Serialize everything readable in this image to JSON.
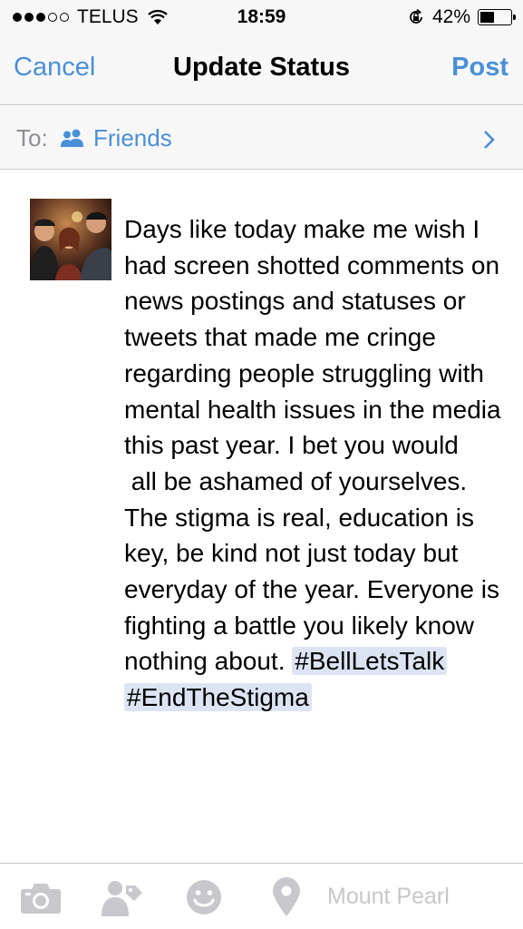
{
  "status_bar": {
    "carrier": "TELUS",
    "time": "18:59",
    "battery_percent": "42%",
    "signal_bars": 3,
    "battery_level": 0.42
  },
  "nav": {
    "cancel_label": "Cancel",
    "title": "Update Status",
    "post_label": "Post"
  },
  "audience": {
    "to_label": "To:",
    "value": "Friends",
    "icon": "friends-icon"
  },
  "post": {
    "body": "Days like today make me wish I had screen shotted comments on news postings and statuses or tweets that made me cringe regarding people struggling with mental health issues in the media this past year. I bet you would\n all be ashamed of yourselves. The stigma is real, education is key, be kind not just today but everyday of the year. Everyone is fighting a battle you likely know nothing about. ",
    "hashtags": [
      "#BellLetsTalk",
      "#EndTheStigma"
    ]
  },
  "toolbar": {
    "icons": [
      "camera-icon",
      "tag-friends-icon",
      "feeling-icon",
      "location-pin-icon"
    ],
    "location_placeholder": "Mount Pearl"
  },
  "colors": {
    "accent": "#4a90d9",
    "bar_background": "#f7f7f8",
    "hashtag_highlight": "#dce4f4",
    "disabled_icon": "#c7c7cc"
  }
}
